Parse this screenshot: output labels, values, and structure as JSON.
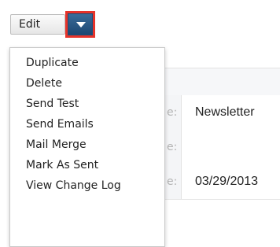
{
  "toolbar": {
    "edit_label": "Edit"
  },
  "icons": {
    "caret": "caret-down-icon"
  },
  "colors": {
    "caret_bg": "#1f4e79",
    "highlight_border": "#e6332a"
  },
  "menu": {
    "items": [
      {
        "label": "Duplicate"
      },
      {
        "label": "Delete"
      },
      {
        "label": "Send Test"
      },
      {
        "label": "Send Emails"
      },
      {
        "label": "Mail Merge"
      },
      {
        "label": "Mark As Sent"
      },
      {
        "label": "View Change Log"
      }
    ]
  },
  "record": {
    "rows": [
      {
        "label_tail": "e:",
        "value": "Newsletter"
      },
      {
        "label_tail": "e:",
        "value": ""
      },
      {
        "label_tail": "e:",
        "value": "03/29/2013"
      }
    ]
  }
}
